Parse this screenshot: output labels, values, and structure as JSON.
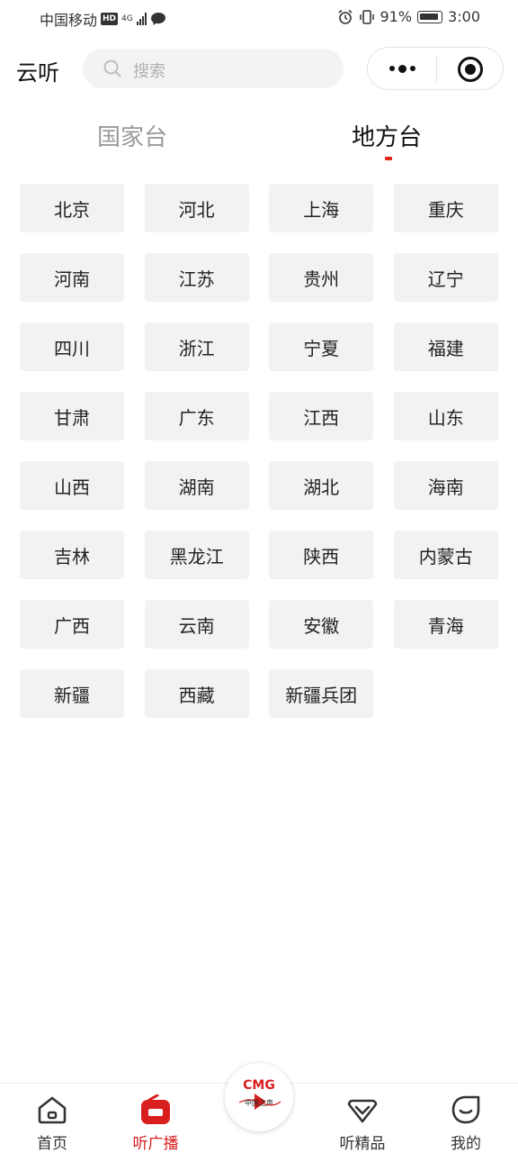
{
  "status": {
    "carrier": "中国移动",
    "hd": "HD",
    "network": "4G",
    "battery": "91%",
    "time": "3:00"
  },
  "header": {
    "title": "云听",
    "search_placeholder": "搜索"
  },
  "tabs": {
    "national": "国家台",
    "local": "地方台",
    "active": "local"
  },
  "regions": [
    "北京",
    "河北",
    "上海",
    "重庆",
    "河南",
    "江苏",
    "贵州",
    "辽宁",
    "四川",
    "浙江",
    "宁夏",
    "福建",
    "甘肃",
    "广东",
    "江西",
    "山东",
    "山西",
    "湖南",
    "湖北",
    "海南",
    "吉林",
    "黑龙江",
    "陕西",
    "内蒙古",
    "广西",
    "云南",
    "安徽",
    "青海",
    "新疆",
    "西藏",
    "新疆兵团"
  ],
  "bottom_nav": {
    "home": "首页",
    "radio": "听广播",
    "center_logo": "CMG",
    "center_sub": "中国之声",
    "premium": "听精品",
    "mine": "我的"
  },
  "colors": {
    "accent": "#d81e1e",
    "tile_bg": "#f2f2f2"
  }
}
